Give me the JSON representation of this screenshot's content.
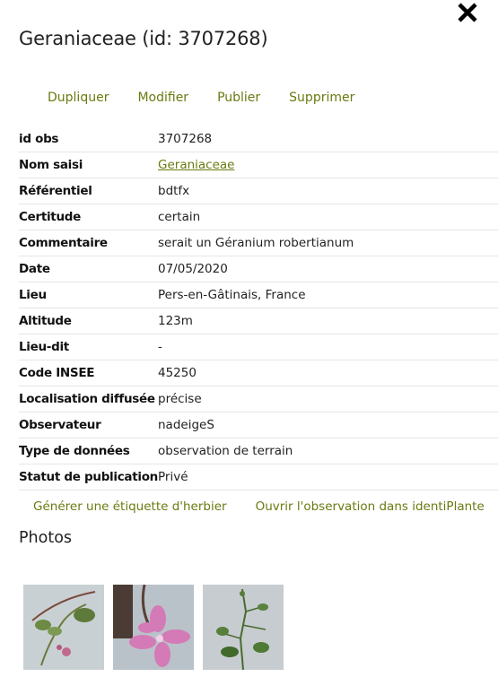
{
  "title": "Geraniaceae (id: 3707268)",
  "actions": [
    "Dupliquer",
    "Modifier",
    "Publier",
    "Supprimer"
  ],
  "details": [
    {
      "label": "id obs",
      "value": "3707268"
    },
    {
      "label": "Nom saisi",
      "value": "Geraniaceae"
    },
    {
      "label": "Référentiel",
      "value": "bdtfx"
    },
    {
      "label": "Certitude",
      "value": "certain"
    },
    {
      "label": "Commentaire",
      "value": "serait un Géranium robertianum"
    },
    {
      "label": "Date",
      "value": "07/05/2020"
    },
    {
      "label": "Lieu",
      "value": "Pers-en-Gâtinais, France"
    },
    {
      "label": "Altitude",
      "value": "123m"
    },
    {
      "label": "Lieu-dit",
      "value": "-"
    },
    {
      "label": "Code INSEE",
      "value": "45250"
    },
    {
      "label": "Localisation diffusée",
      "value": "précise"
    },
    {
      "label": "Observateur",
      "value": "nadeigeS"
    },
    {
      "label": "Type de données",
      "value": "observation de terrain"
    },
    {
      "label": "Statut de publication",
      "value": "Privé"
    }
  ],
  "extra_links": [
    "Générer une étiquette d'herbier",
    "Ouvrir l'observation dans identiPlante"
  ],
  "photos_title": "Photos",
  "photos": [
    {
      "icon": "photo-thumbnail"
    },
    {
      "icon": "photo-thumbnail"
    },
    {
      "icon": "photo-thumbnail"
    }
  ],
  "colors": {
    "accent": "#6b7a10",
    "text": "#222222",
    "divider": "#e6e6e6"
  }
}
